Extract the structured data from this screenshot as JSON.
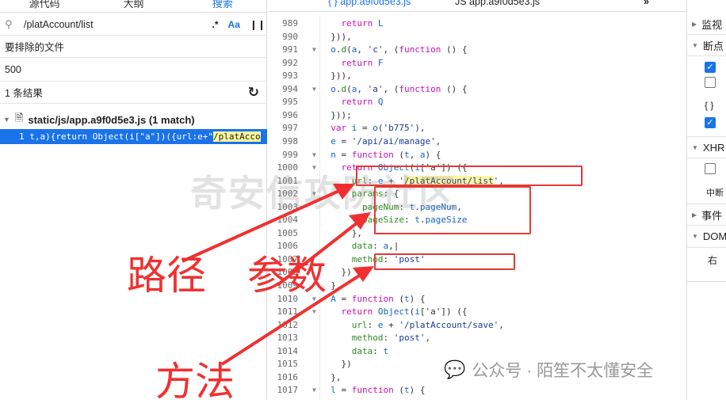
{
  "left": {
    "tabs": [
      "源代码",
      "大纲",
      "搜索"
    ],
    "search_value": "/platAccount/list",
    "regex_label": ".*",
    "case_label": "Aa",
    "word_label": "❙❙",
    "exclude_label": "要排除的文件",
    "exclude_value": "500",
    "result_count": "1 条结果",
    "file": "static/js/app.a9f0d5e3.js (1 match)",
    "match_prefix": "1 t,a){return Object(i[\"a\"])({url:e+\"",
    "match_hl": "/platAcco"
  },
  "editor": {
    "tab1": "{ } app.a9f0d5e3.js",
    "tab2": "JS app.a9f0d5e3.js",
    "lines": [
      {
        "n": "989",
        "f": false,
        "t": [
          [
            "kw",
            "    return "
          ],
          [
            "id",
            "L"
          ]
        ]
      },
      {
        "n": "990",
        "f": false,
        "t": [
          [
            "pu",
            "  })),"
          ]
        ]
      },
      {
        "n": "991",
        "f": true,
        "t": [
          [
            "id",
            "  o"
          ],
          [
            "pu",
            "."
          ],
          [
            "cl",
            "d"
          ],
          [
            "pu",
            "("
          ],
          [
            "id",
            "a"
          ],
          [
            "pu",
            ", "
          ],
          [
            "st",
            "'c'"
          ],
          [
            "pu",
            ", ("
          ],
          [
            "fn",
            "function"
          ],
          [
            "pu",
            " () {"
          ]
        ]
      },
      {
        "n": "992",
        "f": false,
        "t": [
          [
            "kw",
            "    return "
          ],
          [
            "id",
            "F"
          ]
        ]
      },
      {
        "n": "993",
        "f": false,
        "t": [
          [
            "pu",
            "  })),"
          ]
        ]
      },
      {
        "n": "994",
        "f": true,
        "t": [
          [
            "id",
            "  o"
          ],
          [
            "pu",
            "."
          ],
          [
            "cl",
            "d"
          ],
          [
            "pu",
            "("
          ],
          [
            "id",
            "a"
          ],
          [
            "pu",
            ", "
          ],
          [
            "st",
            "'a'"
          ],
          [
            "pu",
            ", ("
          ],
          [
            "fn",
            "function"
          ],
          [
            "pu",
            " () {"
          ]
        ]
      },
      {
        "n": "995",
        "f": false,
        "t": [
          [
            "kw",
            "    return "
          ],
          [
            "id",
            "Q"
          ]
        ]
      },
      {
        "n": "996",
        "f": false,
        "t": [
          [
            "pu",
            "  }));"
          ]
        ]
      },
      {
        "n": "997",
        "f": false,
        "t": [
          [
            "kw",
            "  var "
          ],
          [
            "id",
            "i"
          ],
          [
            "pu",
            " = "
          ],
          [
            "id",
            "o"
          ],
          [
            "pu",
            "("
          ],
          [
            "st",
            "'b775'"
          ],
          [
            "pu",
            "),"
          ]
        ]
      },
      {
        "n": "998",
        "f": false,
        "t": [
          [
            "id",
            "  e"
          ],
          [
            "pu",
            " = "
          ],
          [
            "st",
            "'/api/ai/manage'"
          ],
          [
            "pu",
            ","
          ]
        ]
      },
      {
        "n": "999",
        "f": true,
        "t": [
          [
            "id",
            "  n"
          ],
          [
            "pu",
            " = "
          ],
          [
            "fn",
            "function"
          ],
          [
            "pu",
            " ("
          ],
          [
            "id",
            "t"
          ],
          [
            "pu",
            ", "
          ],
          [
            "id",
            "a"
          ],
          [
            "pu",
            ") {"
          ]
        ]
      },
      {
        "n": "1000",
        "f": true,
        "t": [
          [
            "kw",
            "    return "
          ],
          [
            "id",
            "Object"
          ],
          [
            "pu",
            "("
          ],
          [
            "id",
            "i"
          ],
          [
            "pu",
            "['a']) ({"
          ]
        ]
      },
      {
        "n": "1001",
        "f": false,
        "t": [
          [
            "pr",
            "      url"
          ],
          [
            "pu",
            ": "
          ],
          [
            "id",
            "e"
          ],
          [
            "pu",
            " + "
          ],
          [
            "st",
            "'"
          ],
          [
            "hl",
            "/platAccount/list"
          ],
          [
            "st",
            "'"
          ],
          [
            "pu",
            ","
          ]
        ]
      },
      {
        "n": "1002",
        "f": true,
        "t": [
          [
            "pr",
            "      params"
          ],
          [
            "pu",
            ": {"
          ]
        ]
      },
      {
        "n": "1003",
        "f": false,
        "t": [
          [
            "pr",
            "        pageNum"
          ],
          [
            "pu",
            ": "
          ],
          [
            "id",
            "t"
          ],
          [
            "pu",
            "."
          ],
          [
            "id",
            "pageNum"
          ],
          [
            "pu",
            ","
          ]
        ]
      },
      {
        "n": "1004",
        "f": false,
        "t": [
          [
            "pr",
            "        pageSize"
          ],
          [
            "pu",
            ": "
          ],
          [
            "id",
            "t"
          ],
          [
            "pu",
            "."
          ],
          [
            "id",
            "pageSize"
          ]
        ]
      },
      {
        "n": "1005",
        "f": false,
        "t": [
          [
            "pu",
            "      },"
          ]
        ]
      },
      {
        "n": "1006",
        "f": false,
        "t": [
          [
            "pr",
            "      data"
          ],
          [
            "pu",
            ": "
          ],
          [
            "id",
            "a"
          ],
          [
            "pu",
            ",|"
          ]
        ]
      },
      {
        "n": "1007",
        "f": false,
        "t": [
          [
            "pr",
            "      method"
          ],
          [
            "pu",
            ": "
          ],
          [
            "st",
            "'post'"
          ]
        ]
      },
      {
        "n": "1008",
        "f": false,
        "t": [
          [
            "pu",
            "    })"
          ]
        ]
      },
      {
        "n": "1009",
        "f": false,
        "t": [
          [
            "pu",
            "  },"
          ]
        ]
      },
      {
        "n": "1010",
        "f": true,
        "t": [
          [
            "id",
            "  A"
          ],
          [
            "pu",
            " = "
          ],
          [
            "fn",
            "function"
          ],
          [
            "pu",
            " ("
          ],
          [
            "id",
            "t"
          ],
          [
            "pu",
            ") {"
          ]
        ]
      },
      {
        "n": "1011",
        "f": true,
        "t": [
          [
            "kw",
            "    return "
          ],
          [
            "id",
            "Object"
          ],
          [
            "pu",
            "("
          ],
          [
            "id",
            "i"
          ],
          [
            "pu",
            "['a']) ({"
          ]
        ]
      },
      {
        "n": "1012",
        "f": false,
        "t": [
          [
            "pr",
            "      url"
          ],
          [
            "pu",
            ": "
          ],
          [
            "id",
            "e"
          ],
          [
            "pu",
            " + "
          ],
          [
            "st",
            "'/platAccount/save'"
          ],
          [
            "pu",
            ","
          ]
        ]
      },
      {
        "n": "1013",
        "f": false,
        "t": [
          [
            "pr",
            "      method"
          ],
          [
            "pu",
            ": "
          ],
          [
            "st",
            "'post'"
          ],
          [
            "pu",
            ","
          ]
        ]
      },
      {
        "n": "1014",
        "f": false,
        "t": [
          [
            "pr",
            "      data"
          ],
          [
            "pu",
            ": "
          ],
          [
            "id",
            "t"
          ]
        ]
      },
      {
        "n": "1015",
        "f": false,
        "t": [
          [
            "pu",
            "    })"
          ]
        ]
      },
      {
        "n": "1016",
        "f": false,
        "t": [
          [
            "pu",
            "  },"
          ]
        ]
      },
      {
        "n": "1017",
        "f": true,
        "t": [
          [
            "id",
            "  l"
          ],
          [
            "pu",
            " = "
          ],
          [
            "fn",
            "function"
          ],
          [
            "pu",
            " ("
          ],
          [
            "id",
            "t"
          ],
          [
            "pu",
            ") {"
          ]
        ]
      }
    ]
  },
  "right": {
    "watch": "监视",
    "breakpoints": "断点",
    "braces": "{ }",
    "xhr": "XHR",
    "pause": "中断",
    "events": "事件",
    "dom": "DOM",
    "bottom": "右"
  },
  "annotations": {
    "path": "路径",
    "params": "参数",
    "method": "方法"
  },
  "watermark": "奇安信攻防社区",
  "credit": "公众号 · 陌笙不太懂安全"
}
